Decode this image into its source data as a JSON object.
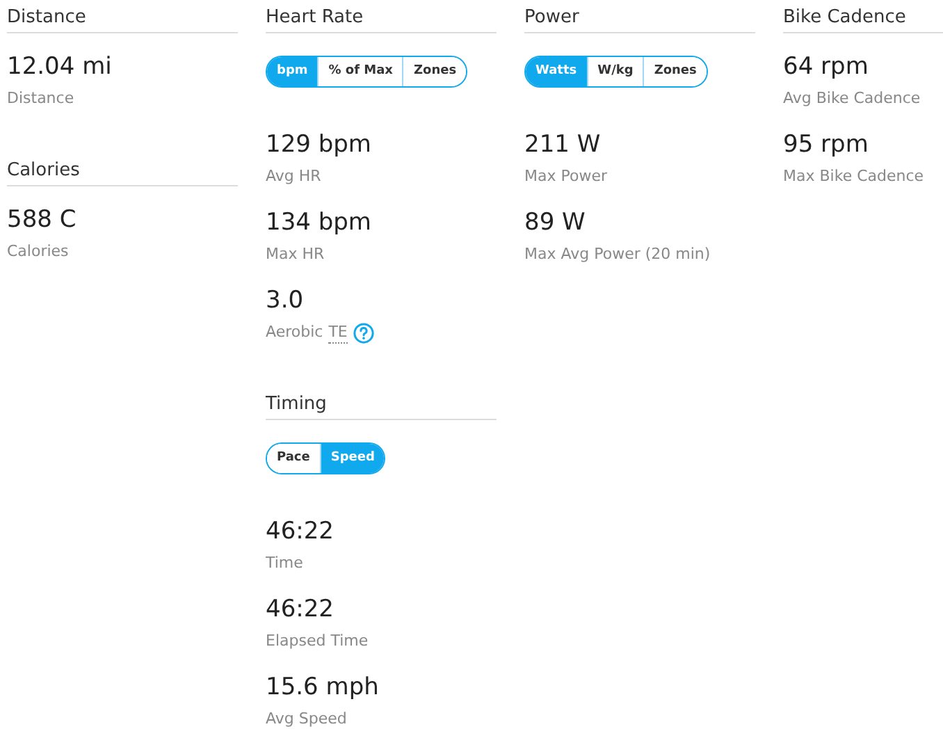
{
  "columns": [
    {
      "sections": [
        {
          "title": "Distance",
          "stats": [
            {
              "value": "12.04 mi",
              "label": "Distance"
            }
          ]
        },
        {
          "title": "Calories",
          "stats": [
            {
              "value": "588 C",
              "label": "Calories"
            }
          ]
        }
      ]
    },
    {
      "sections": [
        {
          "title": "Heart Rate",
          "toggle": [
            {
              "label": "bpm",
              "selected": true
            },
            {
              "label": "% of Max",
              "selected": false
            },
            {
              "label": "Zones",
              "selected": false
            }
          ],
          "stats": [
            {
              "value": "129 bpm",
              "label": "Avg HR"
            },
            {
              "value": "134 bpm",
              "label": "Max HR"
            },
            {
              "value": "3.0",
              "label": "Aerobic",
              "abbr": "TE",
              "help": true
            }
          ]
        },
        {
          "title": "Timing",
          "toggle": [
            {
              "label": "Pace",
              "selected": false
            },
            {
              "label": "Speed",
              "selected": true
            }
          ],
          "stats": [
            {
              "value": "46:22",
              "label": "Time"
            },
            {
              "value": "46:22",
              "label": "Elapsed Time"
            },
            {
              "value": "15.6 mph",
              "label": "Avg Speed"
            }
          ]
        }
      ]
    },
    {
      "sections": [
        {
          "title": "Power",
          "toggle": [
            {
              "label": "Watts",
              "selected": true
            },
            {
              "label": "W/kg",
              "selected": false
            },
            {
              "label": "Zones",
              "selected": false
            }
          ],
          "stats": [
            {
              "value": "211 W",
              "label": "Max Power"
            },
            {
              "value": "89 W",
              "label": "Max Avg Power (20 min)"
            }
          ]
        }
      ]
    },
    {
      "sections": [
        {
          "title": "Bike Cadence",
          "stats": [
            {
              "value": "64 rpm",
              "label": "Avg Bike Cadence"
            },
            {
              "value": "95 rpm",
              "label": "Max Bike Cadence"
            }
          ]
        }
      ]
    }
  ]
}
